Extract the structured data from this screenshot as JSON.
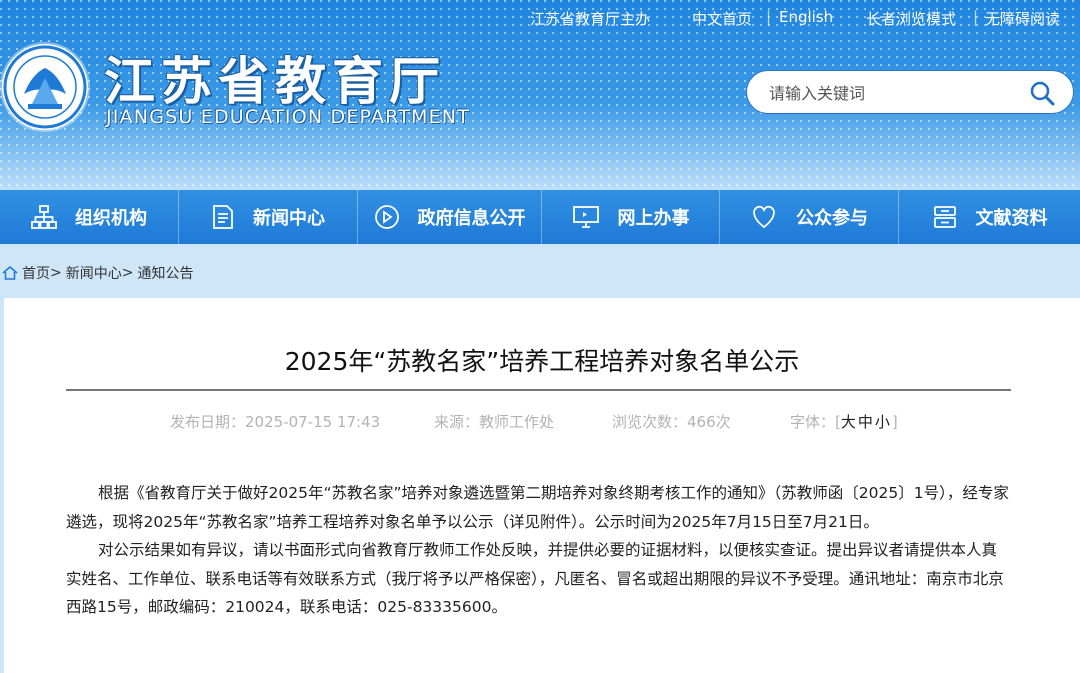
{
  "top_links": {
    "host": "江苏省教育厅主办",
    "home_cn": "中文首页",
    "english": "English",
    "elder_mode": "长者浏览模式",
    "accessibility": "无障碍阅读"
  },
  "site": {
    "title_cn": "江苏省教育厅",
    "title_en": "JIANGSU EDUCATION DEPARTMENT"
  },
  "search": {
    "placeholder": "请输入关键词"
  },
  "nav": [
    {
      "label": "组织机构",
      "icon": "org-chart-icon"
    },
    {
      "label": "新闻中心",
      "icon": "document-icon"
    },
    {
      "label": "政府信息公开",
      "icon": "play-circle-icon"
    },
    {
      "label": "网上办事",
      "icon": "monitor-icon"
    },
    {
      "label": "公众参与",
      "icon": "heart-icon"
    },
    {
      "label": "文献资料",
      "icon": "archive-icon"
    }
  ],
  "breadcrumb": {
    "home": "首页",
    "sep1": ">",
    "news": "新闻中心",
    "sep2": ">",
    "current": "通知公告"
  },
  "article": {
    "title": "2025年“苏教名家”培养工程培养对象名单公示",
    "publish_label": "发布日期：",
    "publish_date": "2025-07-15 17:43",
    "source_label": "来源：",
    "source": "教师工作处",
    "views_label": "浏览次数：",
    "views": "466次",
    "font_label": "字体：[",
    "font_large": "大",
    "font_medium": "中",
    "font_small": "小",
    "font_close": "]",
    "paragraphs": [
      "根据《省教育厅关于做好2025年“苏教名家”培养对象遴选暨第二期培养对象终期考核工作的通知》（苏教师函〔2025〕1号），经专家遴选，现将2025年“苏教名家”培养工程培养对象名单予以公示（详见附件）。公示时间为2025年7月15日至7月21日。",
      "对公示结果如有异议，请以书面形式向省教育厅教师工作处反映，并提供必要的证据材料，以便核实查证。提出异议者请提供本人真实姓名、工作单位、联系电话等有效联系方式（我厅将予以严格保密），凡匿名、冒名或超出期限的异议不予受理。通讯地址：南京市北京西路15号，邮政编码：210024，联系电话：025-83335600。"
    ]
  },
  "colors": {
    "header_blue": "#1e84de",
    "nav_blue": "#2a86dd",
    "breadcrumb_bg": "#cfe6f8"
  }
}
